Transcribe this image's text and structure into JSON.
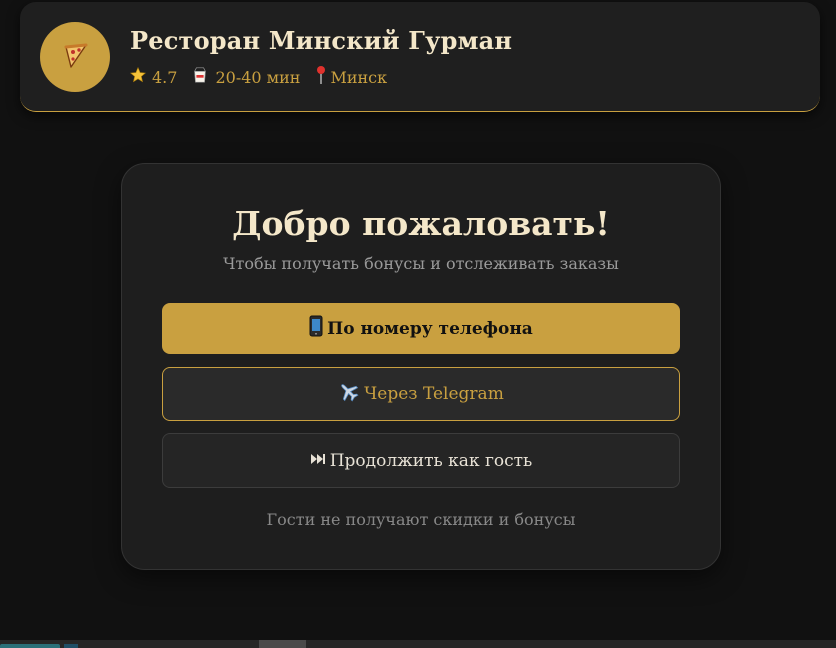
{
  "header": {
    "logo_icon": "pizza-icon",
    "title": "Ресторан Минский Гурман",
    "rating": "4.7",
    "rating_icon": "star-icon",
    "delivery_time": "20-40 мин",
    "delivery_icon": "takeout-box-icon",
    "city": "Минск",
    "city_icon": "map-pin-icon"
  },
  "auth": {
    "title": "Добро пожаловать!",
    "subtitle": "Чтобы получать бонусы и отслеживать заказы",
    "phone_button": "По номеру телефона",
    "phone_icon": "mobile-phone-icon",
    "telegram_button": "Через Telegram",
    "telegram_icon": "airplane-icon",
    "guest_button": "Продолжить как гость",
    "guest_icon": "skip-forward-icon",
    "guest_note": "Гости не получают скидки и бонусы"
  },
  "colors": {
    "accent": "#c9a040",
    "background": "#111111",
    "card": "#1e1e1e",
    "title_text": "#f4e7c9"
  }
}
